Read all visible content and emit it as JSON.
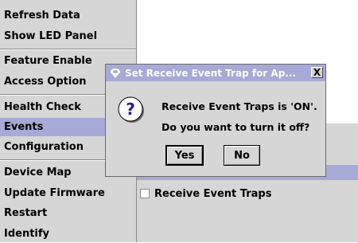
{
  "menu": {
    "items": [
      {
        "label": "Refresh Data"
      },
      {
        "label": "Show LED Panel"
      },
      {
        "label": "Feature Enable"
      },
      {
        "label": "Access Option"
      },
      {
        "label": "Health Check"
      },
      {
        "label": "Events"
      },
      {
        "label": "Configuration"
      },
      {
        "label": "Device Map"
      },
      {
        "label": "Update Firmware"
      },
      {
        "label": "Restart"
      },
      {
        "label": "Identify"
      }
    ],
    "selected": "Events"
  },
  "panel": {
    "checkbox_label": "Receive Event Traps",
    "checkbox_checked": false
  },
  "dialog": {
    "title": "Set Receive Event Trap for Ap...",
    "close_label": "X",
    "message_line1": "Receive Event Traps is 'ON'.",
    "message_line2": "Do you want to turn it off?",
    "yes_label": "Yes",
    "no_label": "No",
    "icon": "question-icon"
  },
  "colors": {
    "panel_bg": "#d6d6d6",
    "selection": "#a7a9d6",
    "title_text": "#ffffff"
  }
}
